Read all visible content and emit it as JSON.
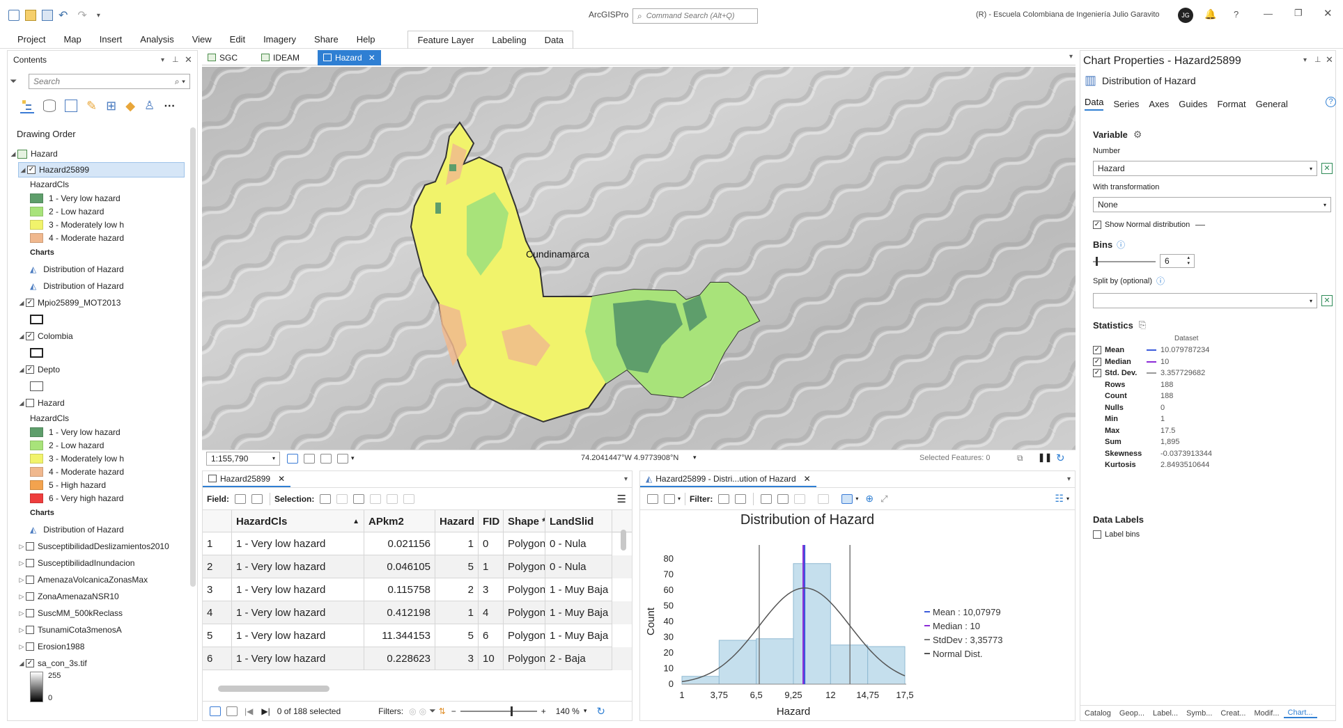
{
  "app": {
    "name": "ArcGISPro",
    "command_search_placeholder": "Command Search (Alt+Q)",
    "org": "(R) - Escuela Colombiana de Ingeniería Julio Garavito",
    "avatar": "JG"
  },
  "ribbon": {
    "tabs": [
      "Project",
      "Map",
      "Insert",
      "Analysis",
      "View",
      "Edit",
      "Imagery",
      "Share",
      "Help"
    ],
    "context_tabs": [
      "Feature Layer",
      "Labeling",
      "Data"
    ]
  },
  "contents": {
    "title": "Contents",
    "search_placeholder": "Search",
    "drawing_order": "Drawing Order",
    "root": "Hazard",
    "layer1": {
      "name": "Hazard25899",
      "field": "HazardCls",
      "classes": [
        {
          "label": "1 - Very low hazard",
          "color": "#5e9e6b"
        },
        {
          "label": "2 - Low hazard",
          "color": "#a8e37a"
        },
        {
          "label": "3 - Moderately low h",
          "color": "#f1f36b"
        },
        {
          "label": "4 - Moderate hazard",
          "color": "#f0b88e"
        }
      ],
      "charts_label": "Charts",
      "charts": [
        "Distribution of Hazard",
        "Distribution of Hazard"
      ]
    },
    "mpio": "Mpio25899_MOT2013",
    "colombia": "Colombia",
    "depto": "Depto",
    "hazard2": {
      "name": "Hazard",
      "field": "HazardCls",
      "classes": [
        {
          "label": "1 - Very low hazard",
          "color": "#5e9e6b"
        },
        {
          "label": "2 - Low hazard",
          "color": "#a8e37a"
        },
        {
          "label": "3 - Moderately low h",
          "color": "#f1f36b"
        },
        {
          "label": "4 - Moderate hazard",
          "color": "#f0b88e"
        },
        {
          "label": "5 - High hazard",
          "color": "#f3a34e"
        },
        {
          "label": "6 - Very high hazard",
          "color": "#ee3d3d"
        }
      ],
      "charts_label": "Charts",
      "chart": "Distribution of Hazard"
    },
    "others": [
      "SusceptibilidadDeslizamientos2010",
      "SusceptibilidadInundacion",
      "AmenazaVolcanicaZonasMax",
      "ZonaAmenazaNSR10",
      "SuscMM_500kReclass",
      "TsunamiCota3menosA",
      "Erosion1988"
    ],
    "raster": {
      "name": "sa_con_3s.tif",
      "high": "255",
      "low": "0"
    }
  },
  "map": {
    "tabs": [
      "SGC",
      "IDEAM",
      "Hazard"
    ],
    "active_tab": "Hazard",
    "label": "Cundinamarca",
    "scale": "1:155,790",
    "coords": "74.2041447°W 4.9773908°N",
    "selected": "Selected Features: 0"
  },
  "table": {
    "tab": "Hazard25899",
    "field_label": "Field:",
    "selection_label": "Selection:",
    "columns": [
      "HazardCls",
      "APkm2",
      "Hazard",
      "FID",
      "Shape *",
      "LandSlid"
    ],
    "rows": [
      {
        "n": "1",
        "cls": "1 - Very low hazard",
        "apkm2": "0.021156",
        "hazard": "1",
        "fid": "0",
        "shape": "Polygon",
        "land": "0 - Nula"
      },
      {
        "n": "2",
        "cls": "1 - Very low hazard",
        "apkm2": "0.046105",
        "hazard": "5",
        "fid": "1",
        "shape": "Polygon",
        "land": "0 - Nula"
      },
      {
        "n": "3",
        "cls": "1 - Very low hazard",
        "apkm2": "0.115758",
        "hazard": "2",
        "fid": "3",
        "shape": "Polygon",
        "land": "1 - Muy Baja"
      },
      {
        "n": "4",
        "cls": "1 - Very low hazard",
        "apkm2": "0.412198",
        "hazard": "1",
        "fid": "4",
        "shape": "Polygon",
        "land": "1 - Muy Baja"
      },
      {
        "n": "5",
        "cls": "1 - Very low hazard",
        "apkm2": "11.344153",
        "hazard": "5",
        "fid": "6",
        "shape": "Polygon",
        "land": "1 - Muy Baja"
      },
      {
        "n": "6",
        "cls": "1 - Very low hazard",
        "apkm2": "0.228623",
        "hazard": "3",
        "fid": "10",
        "shape": "Polygon",
        "land": "2 - Baja"
      }
    ],
    "status": "0 of 188 selected",
    "filters_label": "Filters:",
    "zoom": "140 %"
  },
  "chart_panel": {
    "tab": "Hazard25899 - Distri...ution of Hazard",
    "filter_label": "Filter:"
  },
  "chart_data": {
    "type": "bar",
    "title": "Distribution of Hazard",
    "xlabel": "Hazard",
    "ylabel": "Count",
    "bin_edges": [
      1,
      3.75,
      6.5,
      9.25,
      12,
      14.75,
      17.5
    ],
    "xtick_labels": [
      "1",
      "3,75",
      "6,5",
      "9,25",
      "12",
      "14,75",
      "17,5"
    ],
    "values": [
      5,
      28,
      29,
      77,
      25,
      24
    ],
    "ylim": [
      0,
      80
    ],
    "yticks": [
      0,
      10,
      20,
      30,
      40,
      50,
      60,
      70,
      80
    ],
    "mean": 10.07979,
    "median": 10,
    "stddev": 3.35773,
    "legend": [
      "Mean : 10,07979",
      "Median : 10",
      "StdDev : 3,35773",
      "Normal Dist."
    ],
    "colors": {
      "bar": "#c5dfed",
      "bar_edge": "#8fb9d2",
      "mean": "#3b5bdb",
      "median": "#8b2bd6",
      "stddev": "#777777",
      "normal": "#555555"
    }
  },
  "props": {
    "title": "Chart Properties - Hazard25899",
    "subtitle": "Distribution of Hazard",
    "tabs": [
      "Data",
      "Series",
      "Axes",
      "Guides",
      "Format",
      "General"
    ],
    "variable_label": "Variable",
    "number_label": "Number",
    "number_value": "Hazard",
    "transform_label": "With transformation",
    "transform_value": "None",
    "show_normal": "Show Normal distribution",
    "bins_label": "Bins",
    "bins_value": "6",
    "split_label": "Split by (optional)",
    "stats_label": "Statistics",
    "dataset_label": "Dataset",
    "stats": [
      {
        "k": "Mean",
        "v": "10.079787234",
        "check": true,
        "color": "#3b5bdb"
      },
      {
        "k": "Median",
        "v": "10",
        "check": true,
        "color": "#8b2bd6"
      },
      {
        "k": "Std. Dev.",
        "v": "3.357729682",
        "check": true,
        "color": "#999999"
      },
      {
        "k": "Rows",
        "v": "188"
      },
      {
        "k": "Count",
        "v": "188"
      },
      {
        "k": "Nulls",
        "v": "0"
      },
      {
        "k": "Min",
        "v": "1"
      },
      {
        "k": "Max",
        "v": "17.5"
      },
      {
        "k": "Sum",
        "v": "1,895"
      },
      {
        "k": "Skewness",
        "v": "-0.0373913344"
      },
      {
        "k": "Kurtosis",
        "v": "2.8493510644"
      }
    ],
    "data_labels": "Data Labels",
    "label_bins": "Label bins"
  },
  "bottom_tabs": [
    "Catalog",
    "Geop...",
    "Label...",
    "Symb...",
    "Creat...",
    "Modif...",
    "Chart..."
  ]
}
